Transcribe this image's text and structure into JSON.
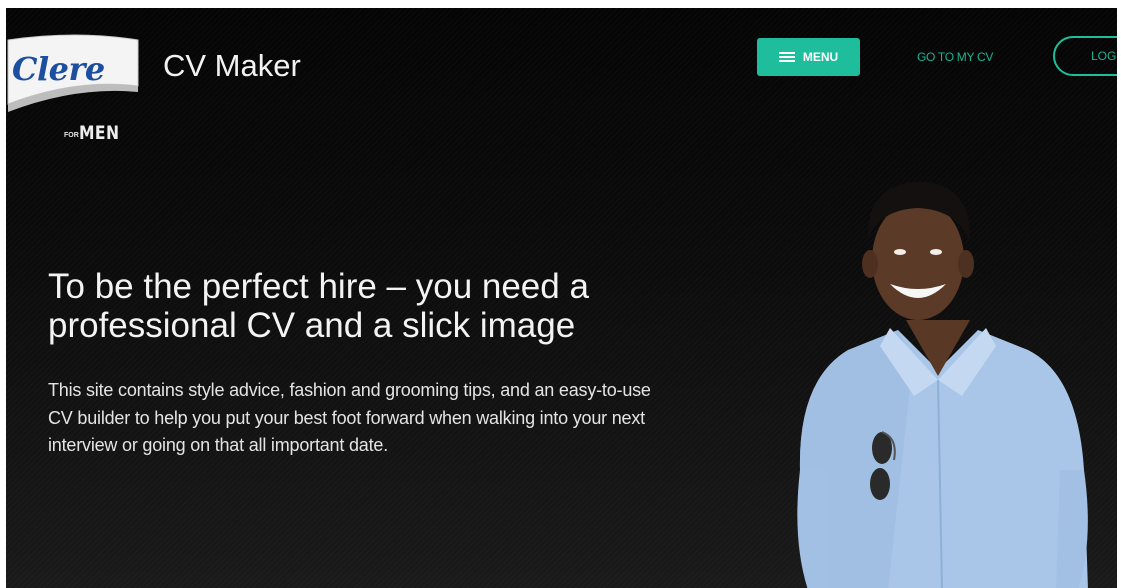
{
  "header": {
    "logo": {
      "brand": "Clere",
      "for": "FOR",
      "men": "MEN"
    },
    "site_title": "CV Maker",
    "nav": {
      "menu_label": "MENU",
      "goto_label": "GO TO MY CV",
      "login_label": "LOG"
    }
  },
  "hero": {
    "headline": "To be the perfect hire – you need a professional CV and a slick image",
    "intro": "This site contains style advice, fashion and grooming tips, and an easy-to-use CV builder to help you put your best foot forward when walking into your next interview or going on that all important date."
  },
  "colors": {
    "accent": "#1ebd9b",
    "background": "#0b0b0b",
    "brand_blue": "#1d4fa0",
    "text": "#f3f3f3"
  },
  "icons": {
    "menu": "hamburger-icon"
  }
}
